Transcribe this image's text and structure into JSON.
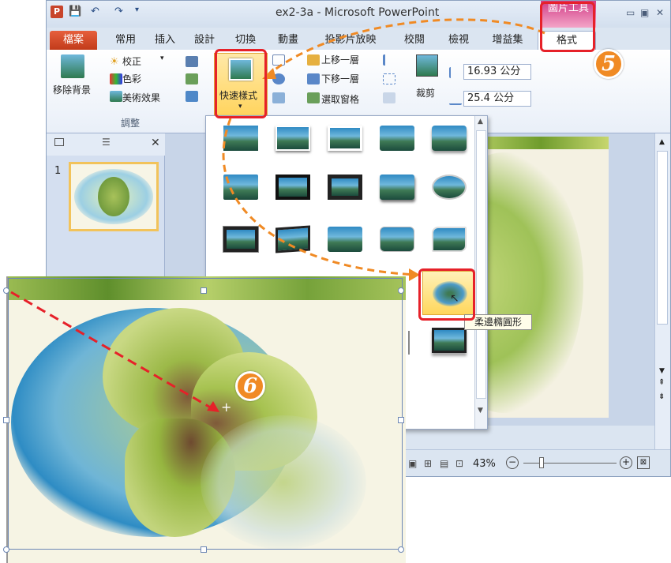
{
  "window": {
    "title": "ex2-3a - Microsoft PowerPoint",
    "context_group": "圖片工具",
    "qat": [
      "💾",
      "↶",
      "↷",
      "▾"
    ]
  },
  "tabs": [
    "檔案",
    "常用",
    "插入",
    "設計",
    "切換",
    "動畫",
    "投影片放映",
    "校閱",
    "檢視",
    "增益集",
    "格式"
  ],
  "ribbon": {
    "remove_background": "移除背景",
    "corrections": "校正",
    "color": "色彩",
    "artistic_effects": "美術效果",
    "adjust_group": "調整",
    "quick_styles": "快速樣式",
    "bring_forward": "上移一層",
    "send_backward": "下移一層",
    "selection_pane": "選取窗格",
    "crop": "裁剪",
    "height_value": "16.93 公分",
    "width_value": "25.4 公分"
  },
  "slides_panel": {
    "slide_number": "1"
  },
  "gallery": {
    "tooltip": "柔邊橢圓形",
    "rows": 6,
    "cols": 5
  },
  "status": {
    "zoom": "43%"
  },
  "annotations": {
    "step5": "5",
    "step6": "6"
  },
  "colors": {
    "accent_orange": "#f08a24",
    "highlight_red": "#e62129",
    "context_pink": "#d23d86"
  }
}
